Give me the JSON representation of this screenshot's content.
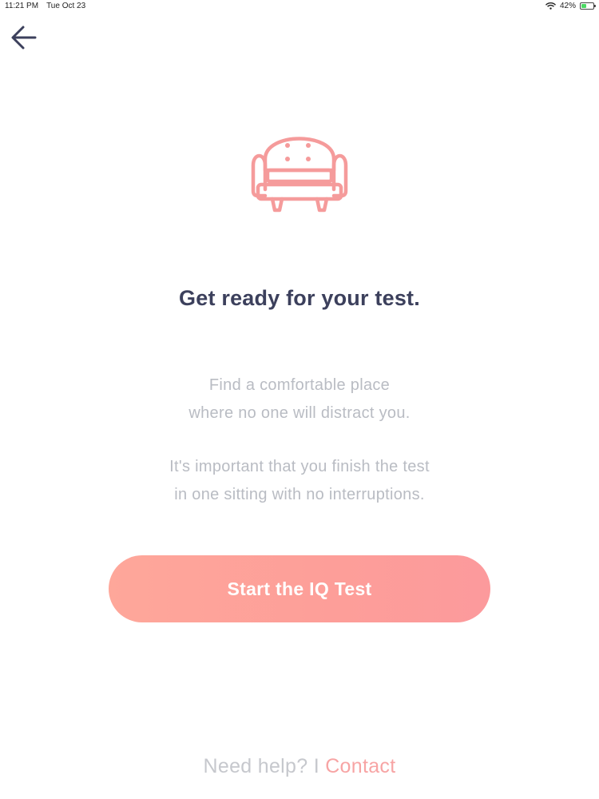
{
  "status_bar": {
    "time": "11:21 PM",
    "date": "Tue Oct 23",
    "battery_percent": "42%",
    "battery_level": 0.42
  },
  "icons": {
    "back": "arrow-left-icon",
    "hero": "armchair-icon",
    "wifi": "wifi-icon",
    "battery": "battery-icon"
  },
  "colors": {
    "title": "#3c405c",
    "body_text": "#b9bcc3",
    "accent": "#fd9e99",
    "contact": "#f7a4a4"
  },
  "main": {
    "title": "Get ready for your test.",
    "paragraph_1": [
      "Find a comfortable place",
      "where no one will distract you."
    ],
    "paragraph_2": [
      "It's important that you finish the test",
      "in one sitting with no interruptions."
    ],
    "start_button_label": "Start the IQ Test"
  },
  "footer": {
    "help_text": "Need help?",
    "separator": "I",
    "contact_label": "Contact"
  }
}
